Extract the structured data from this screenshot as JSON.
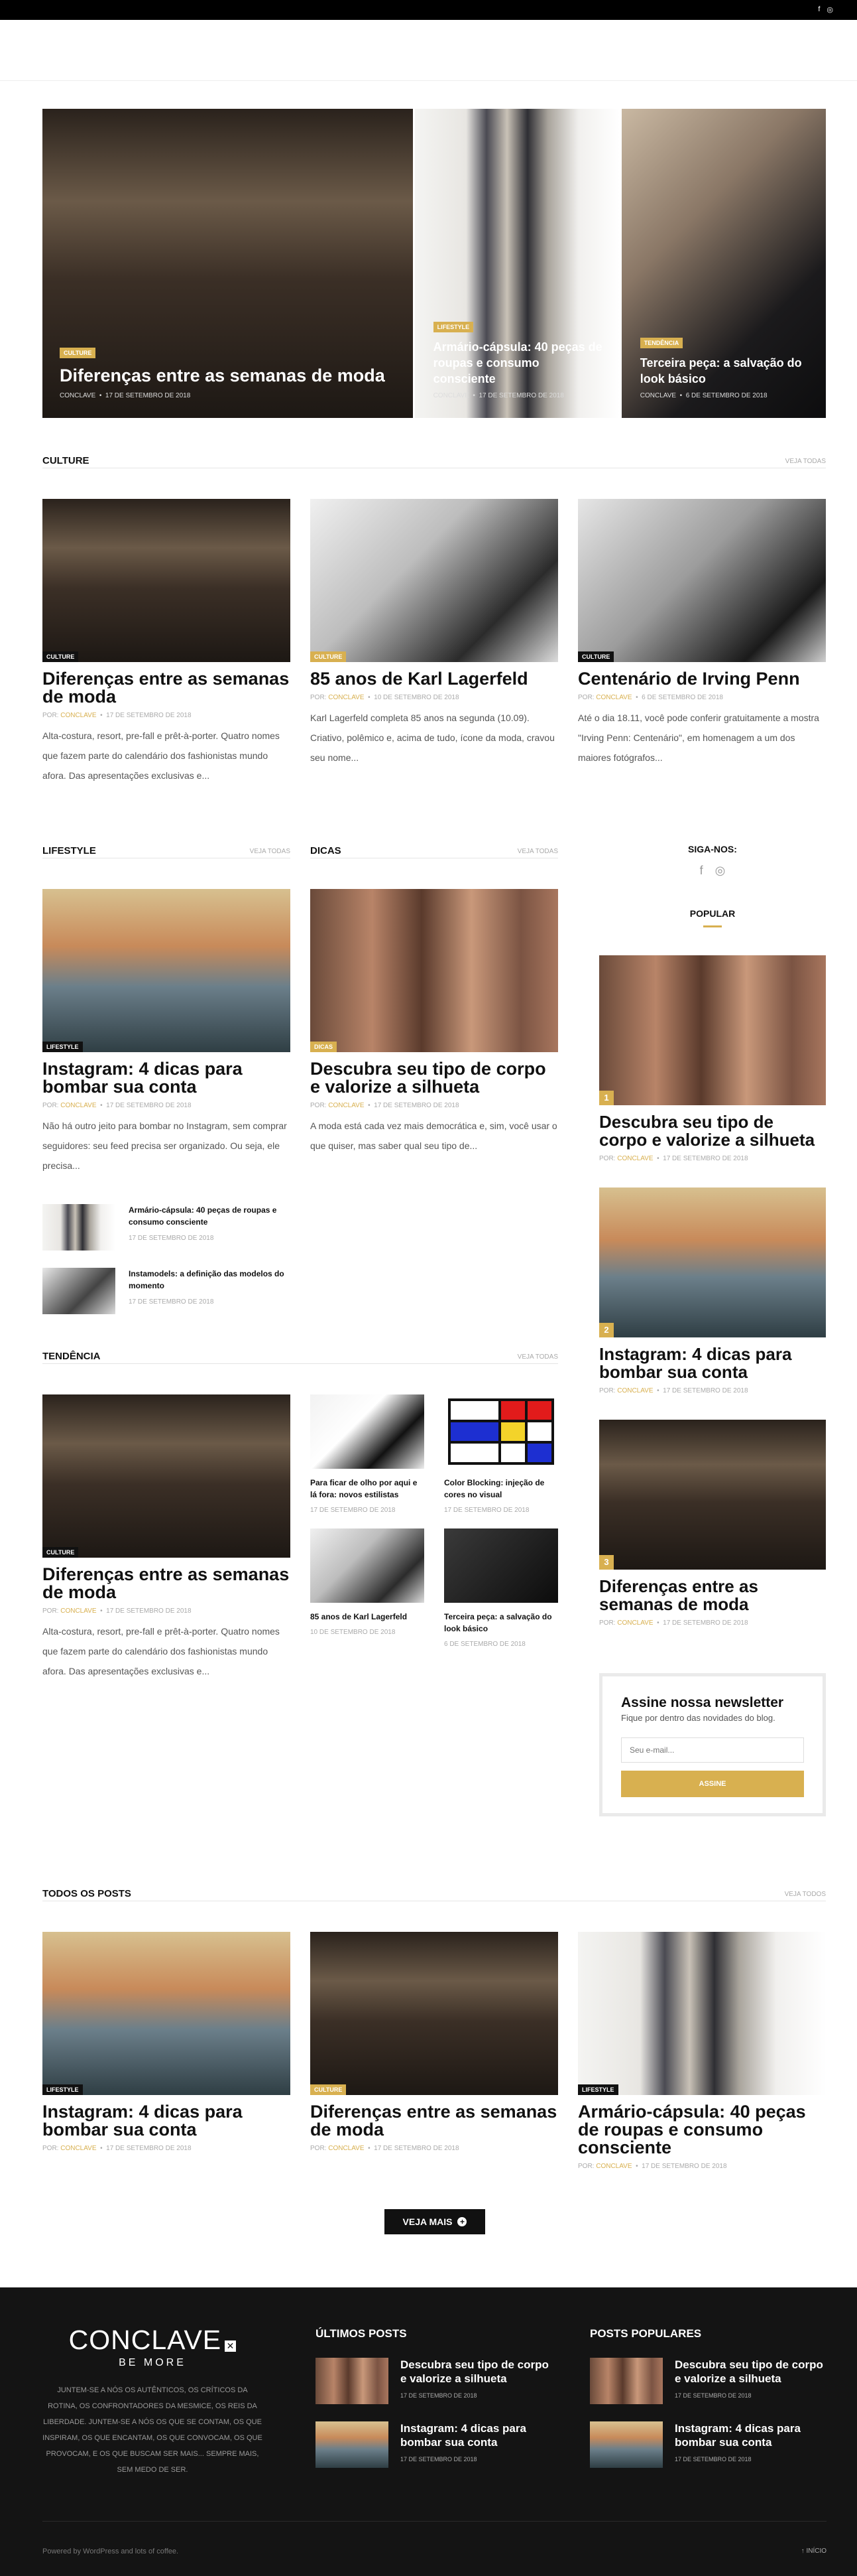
{
  "topbar": {
    "facebook": "f",
    "instagram": "◎"
  },
  "hero": [
    {
      "category": "CULTURE",
      "title": "Diferenças entre as semanas de moda",
      "author": "CONCLAVE",
      "date": "17 DE SETEMBRO DE 2018"
    },
    {
      "category": "LIFESTYLE",
      "title": "Armário-cápsula: 40 peças de roupas e consumo consciente",
      "author": "CONCLAVE",
      "date": "17 DE SETEMBRO DE 2018"
    },
    {
      "category": "TENDÊNCIA",
      "title": "Terceira peça: a salvação do look básico",
      "author": "CONCLAVE",
      "date": "6 DE SETEMBRO DE 2018"
    }
  ],
  "culture": {
    "heading": "CULTURE",
    "view_all": "VEJA TODAS",
    "posts": [
      {
        "category": "CULTURE",
        "title": "Diferenças entre as semanas de moda",
        "by": "POR:",
        "author": "CONCLAVE",
        "date": "17 DE SETEMBRO DE 2018",
        "excerpt": "Alta-costura, resort, pre-fall e prêt-à-porter. Quatro nomes que fazem parte do calendário dos fashionistas mundo afora. Das apresentações exclusivas e..."
      },
      {
        "category": "CULTURE",
        "title": "85 anos de Karl Lagerfeld",
        "by": "POR:",
        "author": "CONCLAVE",
        "date": "10 DE SETEMBRO DE 2018",
        "excerpt": "Karl Lagerfeld completa 85 anos na segunda (10.09). Criativo, polêmico e, acima de tudo, ícone da moda, cravou seu nome..."
      },
      {
        "category": "CULTURE",
        "title": "Centenário de Irving Penn",
        "by": "POR:",
        "author": "CONCLAVE",
        "date": "6 DE SETEMBRO DE 2018",
        "excerpt": "Até o dia 18.11, você pode conferir gratuitamente a mostra \"Irving Penn: Centenário\", em homenagem a um dos maiores fotógrafos..."
      }
    ]
  },
  "lifestyle": {
    "heading": "LIFESTYLE",
    "view_all": "VEJA TODAS",
    "post": {
      "category": "LIFESTYLE",
      "title": "Instagram: 4 dicas para bombar sua conta",
      "by": "POR:",
      "author": "CONCLAVE",
      "date": "17 DE SETEMBRO DE 2018",
      "excerpt": "Não há outro jeito para bombar no Instagram, sem comprar seguidores: seu feed precisa ser organizado. Ou seja, ele precisa..."
    },
    "mini": [
      {
        "title": "Armário-cápsula: 40 peças de roupas e consumo consciente",
        "date": "17 DE SETEMBRO DE 2018"
      },
      {
        "title": "Instamodels: a definição das modelos do momento",
        "date": "17 DE SETEMBRO DE 2018"
      }
    ]
  },
  "dicas": {
    "heading": "DICAS",
    "view_all": "VEJA TODAS",
    "post": {
      "category": "DICAS",
      "title": "Descubra seu tipo de corpo e valorize a silhueta",
      "by": "POR:",
      "author": "CONCLAVE",
      "date": "17 DE SETEMBRO DE 2018",
      "excerpt": "A moda está cada vez mais democrática e, sim, você usar o que quiser, mas saber qual seu tipo de..."
    }
  },
  "sidebar": {
    "follow": "SIGA-NOS:",
    "popular": "POPULAR",
    "popular_posts": [
      {
        "num": "1",
        "title": "Descubra seu tipo de corpo e valorize a silhueta",
        "by": "POR:",
        "author": "CONCLAVE",
        "date": "17 DE SETEMBRO DE 2018"
      },
      {
        "num": "2",
        "title": "Instagram: 4 dicas para bombar sua conta",
        "by": "POR:",
        "author": "CONCLAVE",
        "date": "17 DE SETEMBRO DE 2018"
      },
      {
        "num": "3",
        "title": "Diferenças entre as semanas de moda",
        "by": "POR:",
        "author": "CONCLAVE",
        "date": "17 DE SETEMBRO DE 2018"
      }
    ],
    "newsletter": {
      "title": "Assine nossa newsletter",
      "subtitle": "Fique por dentro das novidades do blog.",
      "placeholder": "Seu e-mail...",
      "button": "ASSINE"
    }
  },
  "tendencia": {
    "heading": "TENDÊNCIA",
    "view_all": "VEJA TODAS",
    "post": {
      "category": "CULTURE",
      "title": "Diferenças entre as semanas de moda",
      "by": "POR:",
      "author": "CONCLAVE",
      "date": "17 DE SETEMBRO DE 2018",
      "excerpt": "Alta-costura, resort, pre-fall e prêt-à-porter. Quatro nomes que fazem parte do calendário dos fashionistas mundo afora. Das apresentações exclusivas e..."
    },
    "small": [
      {
        "title": "Para ficar de olho por aqui e lá fora: novos estilistas",
        "date": "17 DE SETEMBRO DE 2018"
      },
      {
        "title": "Color Blocking: injeção de cores no visual",
        "date": "17 DE SETEMBRO DE 2018"
      },
      {
        "title": "85 anos de Karl Lagerfeld",
        "date": "10 DE SETEMBRO DE 2018"
      },
      {
        "title": "Terceira peça: a salvação do look básico",
        "date": "6 DE SETEMBRO DE 2018"
      }
    ]
  },
  "all_posts": {
    "heading": "TODOS OS POSTS",
    "view_all": "VEJA TODOS",
    "posts": [
      {
        "category": "LIFESTYLE",
        "title": "Instagram: 4 dicas para bombar sua conta",
        "by": "POR:",
        "author": "CONCLAVE",
        "date": "17 DE SETEMBRO DE 2018"
      },
      {
        "category": "CULTURE",
        "title": "Diferenças entre as semanas de moda",
        "by": "POR:",
        "author": "CONCLAVE",
        "date": "17 DE SETEMBRO DE 2018"
      },
      {
        "category": "LIFESTYLE",
        "title": "Armário-cápsula: 40 peças de roupas e consumo consciente",
        "by": "POR:",
        "author": "CONCLAVE",
        "date": "17 DE SETEMBRO DE 2018"
      }
    ],
    "more": "VEJA MAIS"
  },
  "footer": {
    "logo": "CONCLAVE",
    "logo_mark": "✕",
    "tagline": "BE MORE",
    "about": "JUNTEM-SE A NÓS OS AUTÊNTICOS, OS CRÍTICOS DA ROTINA, OS CONFRONTADORES DA MESMICE, OS REIS DA LIBERDADE. JUNTEM-SE A NÓS OS QUE SE CONTAM, OS QUE INSPIRAM, OS QUE ENCANTAM, OS QUE CONVOCAM, OS QUE PROVOCAM, E OS QUE BUSCAM SER MAIS... SEMPRE MAIS, SEM MEDO DE SER.",
    "latest_heading": "ÚLTIMOS POSTS",
    "popular_heading": "POSTS POPULARES",
    "latest": [
      {
        "title": "Descubra seu tipo de corpo e valorize a silhueta",
        "date": "17 DE SETEMBRO DE 2018"
      },
      {
        "title": "Instagram: 4 dicas para bombar sua conta",
        "date": "17 DE SETEMBRO DE 2018"
      }
    ],
    "popular": [
      {
        "title": "Descubra seu tipo de corpo e valorize a silhueta",
        "date": "17 DE SETEMBRO DE 2018"
      },
      {
        "title": "Instagram: 4 dicas para bombar sua conta",
        "date": "17 DE SETEMBRO DE 2018"
      }
    ],
    "powered": "Powered by WordPress and lots of coffee.",
    "back_top": "INÍCIO"
  },
  "colors": {
    "accent": "#d8b050",
    "dark": "#111111"
  }
}
